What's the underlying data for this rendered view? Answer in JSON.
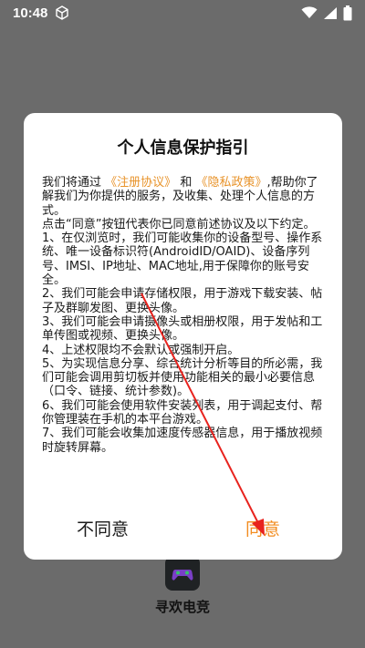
{
  "status_bar": {
    "time": "10:48",
    "icons": [
      "cube-icon",
      "wifi-icon",
      "signal-icon",
      "battery-icon"
    ]
  },
  "home": {
    "app_name": "寻欢电竞"
  },
  "dialog": {
    "title": "个人信息保护指引",
    "intro_prefix": "我们将通过",
    "link_register": "《注册协议》",
    "intro_and": "和",
    "link_privacy": "《隐私政策》",
    "intro_suffix": ",帮助你了解我们为你提供的服务，及收集、处理个人信息的方式。",
    "agree_hint": "点击“同意”按钮代表你已同意前述协议及以下约定。",
    "items": [
      "1、在仅浏览时，我们可能收集你的设备型号、操作系统、唯一设备标识符(AndroidID/OAID)、设备序列号、IMSI、IP地址、MAC地址,用于保障你的账号安全。",
      "2、我们可能会申请存储权限，用于游戏下载安装、帖子及群聊发图、更换头像。",
      "3、我们可能会申请摄像头或相册权限，用于发帖和工单传图或视频、更换头像。",
      "4、上述权限均不会默认或强制开启。",
      "5、为实现信息分享、综合统计分析等目的所必需，我们可能会调用剪切板并使用功能相关的最小必要信息（口令、链接、统计参数)。",
      "6、我们可能会使用软件安装列表，用于调起支付、帮你管理装在手机的本平台游戏。",
      "7、我们可能会收集加速度传感器信息，用于播放视频时旋转屏幕。"
    ],
    "disagree_label": "不同意",
    "agree_label": "同意"
  },
  "colors": {
    "overlay": "#6b6b6b",
    "link": "#e8932a",
    "agree": "#f28c1f",
    "arrow": "#e8231e"
  }
}
